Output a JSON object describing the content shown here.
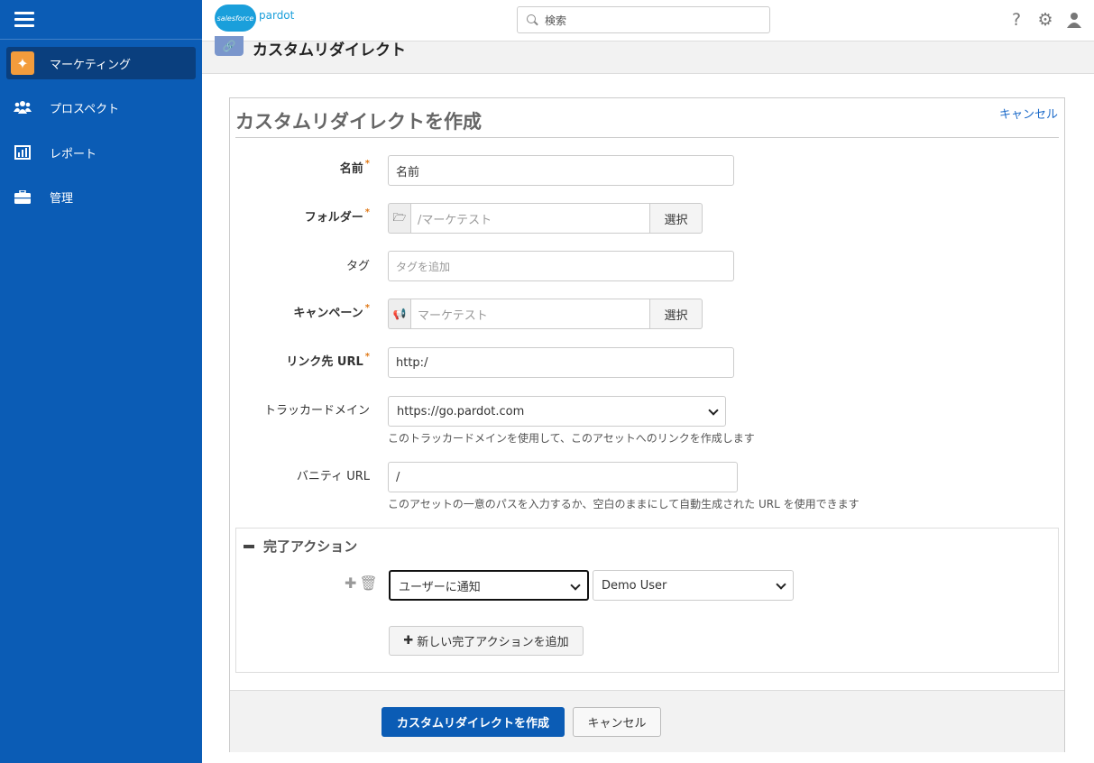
{
  "sidebar": {
    "items": [
      {
        "label": "マーケティング",
        "icon": "magic-wand-icon"
      },
      {
        "label": "プロスペクト",
        "icon": "users-icon"
      },
      {
        "label": "レポート",
        "icon": "bar-chart-icon"
      },
      {
        "label": "管理",
        "icon": "briefcase-icon"
      }
    ]
  },
  "header": {
    "logo_brand": "salesforce",
    "logo_product": "pardot",
    "search_placeholder": "検索"
  },
  "page": {
    "title": "カスタムリダイレクト"
  },
  "form": {
    "title": "カスタムリダイレクトを作成",
    "cancel_link": "キャンセル",
    "fields": {
      "name": {
        "label": "名前",
        "value": "名前"
      },
      "folder": {
        "label": "フォルダー",
        "value": "/マーケテスト",
        "button": "選択"
      },
      "tags": {
        "label": "タグ",
        "placeholder": "タグを追加"
      },
      "campaign": {
        "label": "キャンペーン",
        "value": "マーケテスト",
        "button": "選択"
      },
      "url": {
        "label": "リンク先 URL",
        "value": "http:/"
      },
      "tracker": {
        "label": "トラッカードメイン",
        "value": "https://go.pardot.com",
        "help": "このトラッカードメインを使用して、このアセットへのリンクを作成します"
      },
      "vanity": {
        "label": "バニティ URL",
        "value": "/",
        "help": "このアセットの一意のパスを入力するか、空白のままにして自動生成された URL を使用できます"
      }
    },
    "completion": {
      "title": "完了アクション",
      "action": "ユーザーに通知",
      "user": "Demo User",
      "add_button": "新しい完了アクションを追加"
    },
    "footer": {
      "submit": "カスタムリダイレクトを作成",
      "cancel": "キャンセル"
    }
  },
  "colors": {
    "sidebar": "#0b5cb5",
    "active_item": "#0a3f7e",
    "accent_orange": "#f39c3c",
    "link": "#1b6ac9"
  }
}
